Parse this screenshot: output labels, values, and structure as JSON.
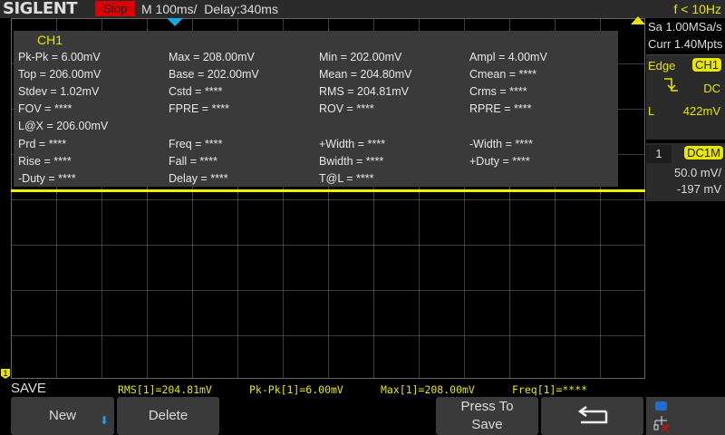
{
  "header": {
    "logo": "SIGLENT",
    "run_state": "Stop",
    "timebase": "M 100ms/",
    "delay": "Delay:340ms",
    "trigger_freq": "f < 10Hz"
  },
  "measure_panel": {
    "channel": "CH1",
    "rows": [
      [
        "Pk-Pk = 6.00mV",
        "Max = 208.00mV",
        "Min = 202.00mV",
        "Ampl = 4.00mV"
      ],
      [
        "Top = 206.00mV",
        "Base = 202.00mV",
        "Mean = 204.80mV",
        "Cmean = ****"
      ],
      [
        "Stdev = 1.02mV",
        "Cstd = ****",
        "RMS = 204.81mV",
        "Crms = ****"
      ],
      [
        "FOV = ****",
        "FPRE = ****",
        "ROV = ****",
        "RPRE = ****"
      ],
      [
        "L@X = 206.00mV",
        "",
        "",
        ""
      ],
      [
        "Prd = ****",
        "Freq = ****",
        "+Width = ****",
        "-Width = ****"
      ],
      [
        "Rise = ****",
        "Fall = ****",
        "Bwidth = ****",
        "+Duty = ****"
      ],
      [
        "-Duty = ****",
        "Delay = ****",
        "T@L = ****",
        ""
      ]
    ]
  },
  "acquisition": {
    "sample_rate": "Sa 1.00MSa/s",
    "memory": "Curr 1.40Mpts"
  },
  "trigger": {
    "type": "Edge",
    "source": "CH1",
    "coupling": "DC",
    "level_label": "L",
    "level": "422mV"
  },
  "channel": {
    "number": "1",
    "coupling": "DC1M",
    "scale": "50.0 mV/",
    "offset": "-197 mV"
  },
  "channel_marker": "1",
  "menu": {
    "title": "SAVE",
    "buttons": {
      "new": "New",
      "delete": "Delete",
      "press_line1": "Press To",
      "press_line2": "Save"
    }
  },
  "measurements": [
    "RMS[1]=204.81mV",
    "Pk-Pk[1]=6.00mV",
    "Max[1]=208.00mV",
    "Freq[1]=****"
  ],
  "colors": {
    "trace": "#f0f000",
    "accent": "#e6e600",
    "stop": "#dd0000",
    "marker": "#1aa7e0"
  }
}
